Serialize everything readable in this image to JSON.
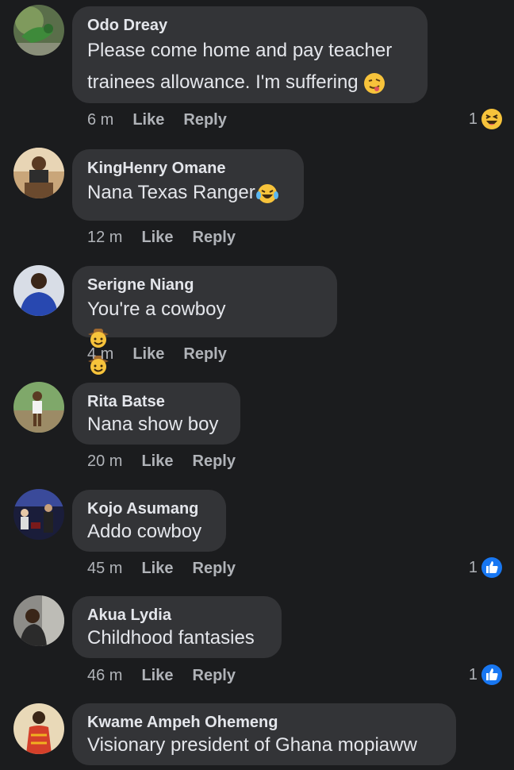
{
  "comments": [
    {
      "name": "Odo Dreay",
      "text": "Please come home and pay teacher\ntrainees allowance. I'm suffering",
      "time": "6 m",
      "like": "Like",
      "reply": "Reply",
      "reaction_count": "1",
      "reaction_icon": "laughing-squint-emoji"
    },
    {
      "name": "KingHenry Omane",
      "text": "Nana Texas Ranger",
      "time": "12 m",
      "like": "Like",
      "reply": "Reply"
    },
    {
      "name": "Serigne Niang",
      "text": "You're a cowboy",
      "time": "4 m",
      "like": "Like",
      "reply": "Reply"
    },
    {
      "name": "Rita Batse",
      "text": "Nana show boy",
      "time": "20 m",
      "like": "Like",
      "reply": "Reply"
    },
    {
      "name": "Kojo Asumang",
      "text": "Addo cowboy",
      "time": "45 m",
      "like": "Like",
      "reply": "Reply",
      "reaction_count": "1",
      "reaction_icon": "like-thumb-icon"
    },
    {
      "name": "Akua Lydia",
      "text": "Childhood fantasies",
      "time": "46 m",
      "like": "Like",
      "reply": "Reply",
      "reaction_count": "1",
      "reaction_icon": "like-thumb-icon"
    },
    {
      "name": "Kwame Ampeh Ohemeng",
      "text": "Visionary president of Ghana mopiaww"
    }
  ],
  "colors": {
    "background": "#1b1c1e",
    "bubble": "#333437",
    "text": "#e4e6eb",
    "meta": "#b0b3b8",
    "like_blue": "#1877f2"
  }
}
